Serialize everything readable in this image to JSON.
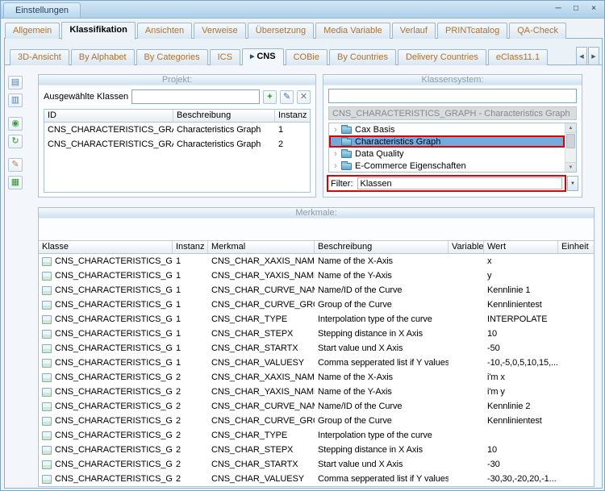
{
  "colors": {
    "highlight": "#e10000",
    "tab_text": "#b0722e",
    "selection": "#74abdd"
  },
  "icons": {
    "expander": "›",
    "dropdown": "▼",
    "scroll_up": "▲",
    "scroll_down": "▼"
  },
  "window": {
    "title": "Einstellungen",
    "minimize_glyph": "─",
    "maximize_glyph": "□",
    "close_glyph": "×"
  },
  "main_tabs": [
    {
      "label": "Allgemein"
    },
    {
      "label": "Klassifikation",
      "active": true
    },
    {
      "label": "Ansichten"
    },
    {
      "label": "Verweise"
    },
    {
      "label": "Übersetzung"
    },
    {
      "label": "Media Variable"
    },
    {
      "label": "Verlauf"
    },
    {
      "label": "PRINTcatalog"
    },
    {
      "label": "QA-Check"
    }
  ],
  "sub_tabs": [
    {
      "label": "3D-Ansicht"
    },
    {
      "label": "By Alphabet"
    },
    {
      "label": "By Categories"
    },
    {
      "label": "ICS"
    },
    {
      "label": "CNS",
      "active": true,
      "arrow": "▶"
    },
    {
      "label": "COBie"
    },
    {
      "label": "By Countries"
    },
    {
      "label": "Delivery Countries"
    },
    {
      "label": "eClass11.1"
    }
  ],
  "tab_scroll": {
    "left_glyph": "◀",
    "right_glyph": "▶"
  },
  "sidebar_icons": [
    {
      "name": "report-icon",
      "glyph": "▤",
      "color": "#4a7fb5"
    },
    {
      "name": "form-icon",
      "glyph": "▥",
      "color": "#4a7fb5"
    },
    {
      "name": "globe-icon",
      "glyph": "◉",
      "color": "#3f9b3f"
    },
    {
      "name": "refresh-icon",
      "glyph": "↻",
      "color": "#2f8f2f"
    },
    {
      "name": "edit-document-icon",
      "glyph": "✎",
      "color": "#c07830"
    },
    {
      "name": "export-document-icon",
      "glyph": "▦",
      "color": "#2f8f2f"
    }
  ],
  "projekt": {
    "header": "Projekt:",
    "selected_classes_label": "Ausgewählte Klassen",
    "input_value": "",
    "add_glyph": "+",
    "edit_glyph": "✎",
    "remove_glyph": "✕",
    "columns": [
      "ID",
      "Beschreibung",
      "Instanz"
    ],
    "rows": [
      {
        "id": "CNS_CHARACTERISTICS_GRAPH",
        "beschreibung": "Characteristics Graph",
        "instanz": "1"
      },
      {
        "id": "CNS_CHARACTERISTICS_GRAPH",
        "beschreibung": "Characteristics Graph",
        "instanz": "2"
      }
    ]
  },
  "klassensystem": {
    "header": "Klassensystem:",
    "search_value": "",
    "selected_class": "CNS_CHARACTERISTICS_GRAPH - Characteristics Graph",
    "tree": [
      {
        "label": "Cax Basis"
      },
      {
        "label": "Characteristics Graph",
        "selected": true
      },
      {
        "label": "Data Quality"
      },
      {
        "label": "E-Commerce Eigenschaften"
      }
    ],
    "filter_label": "Filter:",
    "filter_value": "Klassen"
  },
  "merkmale": {
    "header": "Merkmale:",
    "columns": [
      "Klasse",
      "Instanz",
      "Merkmal",
      "Beschreibung",
      "Variable",
      "Wert",
      "Einheit"
    ],
    "rows": [
      {
        "klasse": "CNS_CHARACTERISTICS_GRAPH",
        "instanz": "1",
        "merkmal": "CNS_CHAR_XAXIS_NAME",
        "beschreibung": "Name of the X-Axis",
        "variable": "",
        "wert": "x",
        "einheit": ""
      },
      {
        "klasse": "CNS_CHARACTERISTICS_GRAPH",
        "instanz": "1",
        "merkmal": "CNS_CHAR_YAXIS_NAME",
        "beschreibung": "Name of the Y-Axis",
        "variable": "",
        "wert": "y",
        "einheit": ""
      },
      {
        "klasse": "CNS_CHARACTERISTICS_GRAPH",
        "instanz": "1",
        "merkmal": "CNS_CHAR_CURVE_NAME",
        "beschreibung": "Name/ID of the Curve",
        "variable": "",
        "wert": "Kennlinie 1",
        "einheit": ""
      },
      {
        "klasse": "CNS_CHARACTERISTICS_GRAPH",
        "instanz": "1",
        "merkmal": "CNS_CHAR_CURVE_GROUP",
        "beschreibung": "Group of the Curve",
        "variable": "",
        "wert": "Kennlinientest",
        "einheit": ""
      },
      {
        "klasse": "CNS_CHARACTERISTICS_GRAPH",
        "instanz": "1",
        "merkmal": "CNS_CHAR_TYPE",
        "beschreibung": "Interpolation type of the curve",
        "variable": "",
        "wert": "INTERPOLATE",
        "einheit": ""
      },
      {
        "klasse": "CNS_CHARACTERISTICS_GRAPH",
        "instanz": "1",
        "merkmal": "CNS_CHAR_STEPX",
        "beschreibung": "Stepping distance in X Axis",
        "variable": "",
        "wert": "10",
        "einheit": ""
      },
      {
        "klasse": "CNS_CHARACTERISTICS_GRAPH",
        "instanz": "1",
        "merkmal": "CNS_CHAR_STARTX",
        "beschreibung": "Start value und X Axis",
        "variable": "",
        "wert": "-50",
        "einheit": ""
      },
      {
        "klasse": "CNS_CHARACTERISTICS_GRAPH",
        "instanz": "1",
        "merkmal": "CNS_CHAR_VALUESY",
        "beschreibung": "Comma sepperated list if Y values",
        "variable": "",
        "wert": "-10,-5,0,5,10,15,...",
        "einheit": ""
      },
      {
        "klasse": "CNS_CHARACTERISTICS_GRAPH",
        "instanz": "2",
        "merkmal": "CNS_CHAR_XAXIS_NAME",
        "beschreibung": "Name of the X-Axis",
        "variable": "",
        "wert": "i'm x",
        "einheit": ""
      },
      {
        "klasse": "CNS_CHARACTERISTICS_GRAPH",
        "instanz": "2",
        "merkmal": "CNS_CHAR_YAXIS_NAME",
        "beschreibung": "Name of the Y-Axis",
        "variable": "",
        "wert": "i'm y",
        "einheit": ""
      },
      {
        "klasse": "CNS_CHARACTERISTICS_GRAPH",
        "instanz": "2",
        "merkmal": "CNS_CHAR_CURVE_NAME",
        "beschreibung": "Name/ID of the Curve",
        "variable": "",
        "wert": "Kennlinie 2",
        "einheit": ""
      },
      {
        "klasse": "CNS_CHARACTERISTICS_GRAPH",
        "instanz": "2",
        "merkmal": "CNS_CHAR_CURVE_GROUP",
        "beschreibung": "Group of the Curve",
        "variable": "",
        "wert": "Kennlinientest",
        "einheit": ""
      },
      {
        "klasse": "CNS_CHARACTERISTICS_GRAPH",
        "instanz": "2",
        "merkmal": "CNS_CHAR_TYPE",
        "beschreibung": "Interpolation type of the curve",
        "variable": "",
        "wert": "",
        "einheit": ""
      },
      {
        "klasse": "CNS_CHARACTERISTICS_GRAPH",
        "instanz": "2",
        "merkmal": "CNS_CHAR_STEPX",
        "beschreibung": "Stepping distance in X Axis",
        "variable": "",
        "wert": "10",
        "einheit": ""
      },
      {
        "klasse": "CNS_CHARACTERISTICS_GRAPH",
        "instanz": "2",
        "merkmal": "CNS_CHAR_STARTX",
        "beschreibung": "Start value und X Axis",
        "variable": "",
        "wert": "-30",
        "einheit": ""
      },
      {
        "klasse": "CNS_CHARACTERISTICS_GRAPH",
        "instanz": "2",
        "merkmal": "CNS_CHAR_VALUESY",
        "beschreibung": "Comma sepperated list if Y values",
        "variable": "",
        "wert": "-30,30,-20,20,-1...",
        "einheit": ""
      }
    ]
  }
}
